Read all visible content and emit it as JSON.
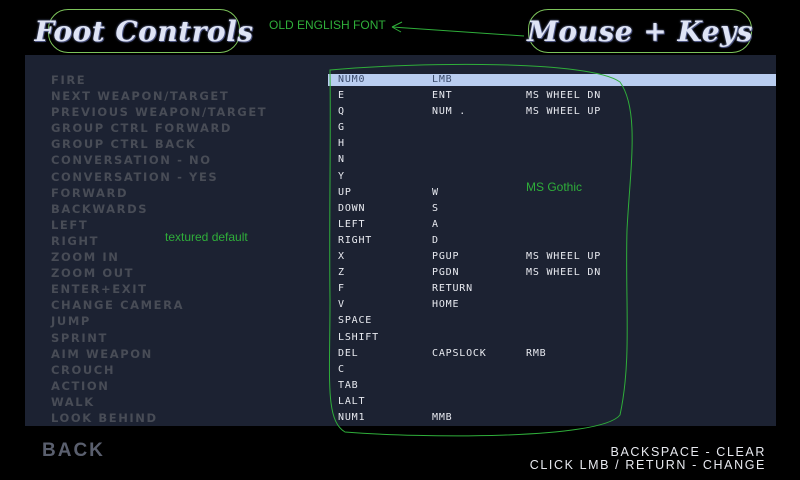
{
  "titles": {
    "foot_controls": "Foot Controls",
    "mouse_keys": "Mouse + Keys"
  },
  "annotations": {
    "old_english": "OLD ENGLISH FONT",
    "ms_gothic": "MS Gothic",
    "textured_default": "textured default"
  },
  "bindings": [
    {
      "action": "FIRE",
      "key1": "NUM0",
      "key2": "LMB",
      "key3": ""
    },
    {
      "action": "NEXT WEAPON/TARGET",
      "key1": "E",
      "key2": "ENT",
      "key3": "MS WHEEL DN"
    },
    {
      "action": "PREVIOUS WEAPON/TARGET",
      "key1": "Q",
      "key2": "NUM .",
      "key3": "MS WHEEL UP"
    },
    {
      "action": "GROUP CTRL FORWARD",
      "key1": "G",
      "key2": "",
      "key3": ""
    },
    {
      "action": "GROUP CTRL BACK",
      "key1": "H",
      "key2": "",
      "key3": ""
    },
    {
      "action": "CONVERSATION - NO",
      "key1": "N",
      "key2": "",
      "key3": ""
    },
    {
      "action": "CONVERSATION - YES",
      "key1": "Y",
      "key2": "",
      "key3": ""
    },
    {
      "action": "FORWARD",
      "key1": "UP",
      "key2": "W",
      "key3": ""
    },
    {
      "action": "BACKWARDS",
      "key1": "DOWN",
      "key2": "S",
      "key3": ""
    },
    {
      "action": "LEFT",
      "key1": "LEFT",
      "key2": "A",
      "key3": ""
    },
    {
      "action": "RIGHT",
      "key1": "RIGHT",
      "key2": "D",
      "key3": ""
    },
    {
      "action": "ZOOM IN",
      "key1": "X",
      "key2": "PGUP",
      "key3": "MS WHEEL UP"
    },
    {
      "action": "ZOOM OUT",
      "key1": "Z",
      "key2": "PGDN",
      "key3": "MS WHEEL DN"
    },
    {
      "action": "ENTER+EXIT",
      "key1": "F",
      "key2": "RETURN",
      "key3": ""
    },
    {
      "action": "CHANGE CAMERA",
      "key1": "V",
      "key2": "HOME",
      "key3": ""
    },
    {
      "action": "JUMP",
      "key1": "SPACE",
      "key2": "",
      "key3": ""
    },
    {
      "action": "SPRINT",
      "key1": "LSHIFT",
      "key2": "",
      "key3": ""
    },
    {
      "action": "AIM WEAPON",
      "key1": "DEL",
      "key2": "CAPSLOCK",
      "key3": "RMB"
    },
    {
      "action": "CROUCH",
      "key1": "C",
      "key2": "",
      "key3": ""
    },
    {
      "action": "ACTION",
      "key1": "TAB",
      "key2": "",
      "key3": ""
    },
    {
      "action": "WALK",
      "key1": "LALT",
      "key2": "",
      "key3": ""
    },
    {
      "action": "LOOK BEHIND",
      "key1": "NUM1",
      "key2": "MMB",
      "key3": ""
    }
  ],
  "selected_row": 0,
  "back_label": "BACK",
  "footer": {
    "hint_clear": "BACKSPACE - CLEAR",
    "hint_change": "CLICK LMB / RETURN - CHANGE"
  },
  "colors": {
    "background": "#000000",
    "panel": "#1c2232",
    "highlight": "#b9cdf0",
    "annotation": "#2fae3a",
    "action_text": "#484c56",
    "key_text": "#e8eaf0"
  }
}
